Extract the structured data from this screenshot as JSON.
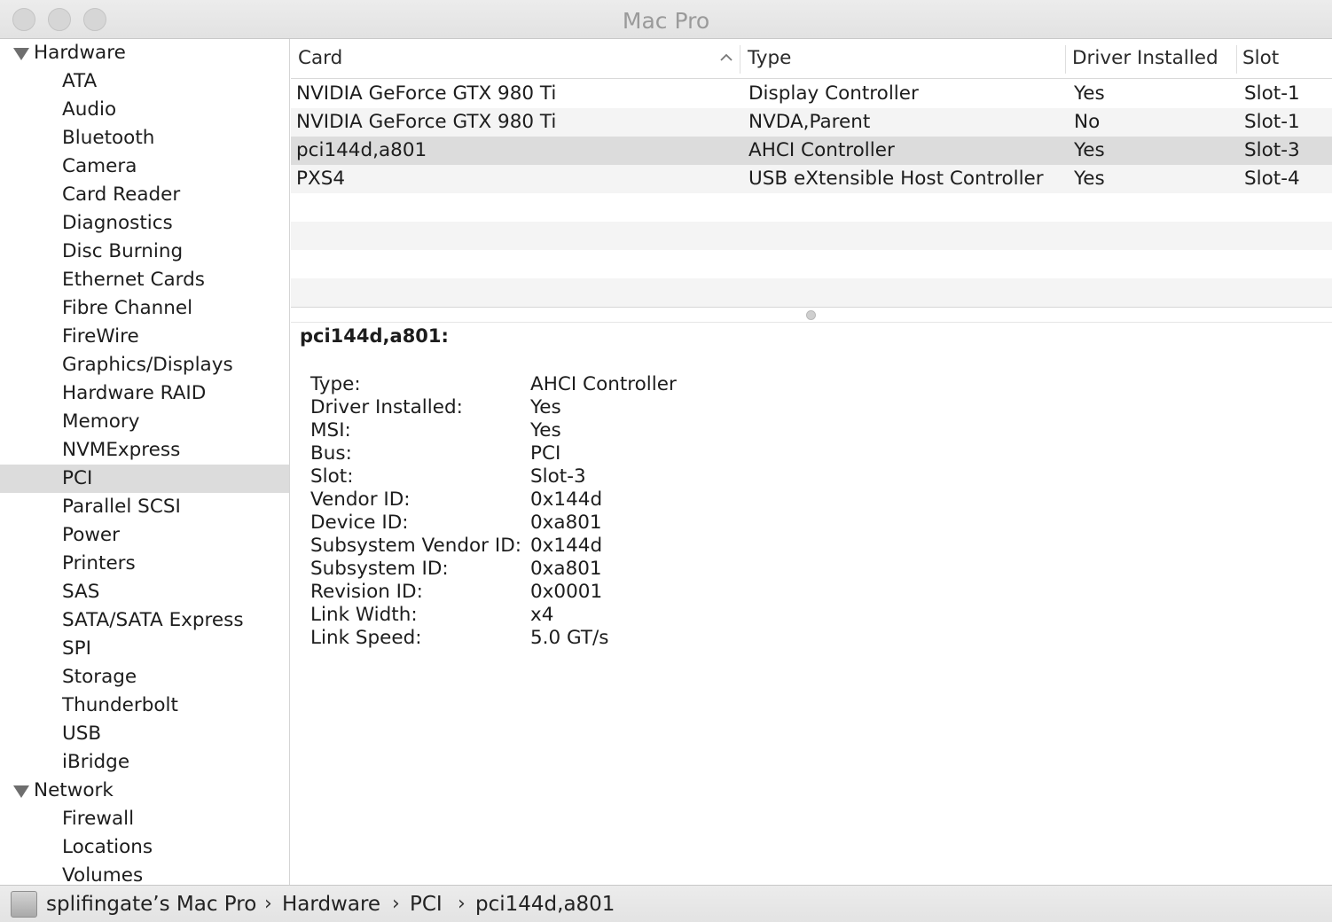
{
  "window": {
    "title": "Mac Pro"
  },
  "sidebar": {
    "groups": [
      {
        "label": "Hardware",
        "items": [
          "ATA",
          "Audio",
          "Bluetooth",
          "Camera",
          "Card Reader",
          "Diagnostics",
          "Disc Burning",
          "Ethernet Cards",
          "Fibre Channel",
          "FireWire",
          "Graphics/Displays",
          "Hardware RAID",
          "Memory",
          "NVMExpress",
          "PCI",
          "Parallel SCSI",
          "Power",
          "Printers",
          "SAS",
          "SATA/SATA Express",
          "SPI",
          "Storage",
          "Thunderbolt",
          "USB",
          "iBridge"
        ]
      },
      {
        "label": "Network",
        "items": [
          "Firewall",
          "Locations",
          "Volumes"
        ]
      }
    ],
    "selected": "PCI"
  },
  "table": {
    "columns": [
      "Card",
      "Type",
      "Driver Installed",
      "Slot"
    ],
    "sort_column": "Card",
    "sort_direction": "ascending",
    "rows": [
      [
        "NVIDIA GeForce GTX 980 Ti",
        "Display Controller",
        "Yes",
        "Slot-1"
      ],
      [
        "NVIDIA GeForce GTX 980 Ti",
        "NVDA,Parent",
        "No",
        "Slot-1"
      ],
      [
        "pci144d,a801",
        "AHCI Controller",
        "Yes",
        "Slot-3"
      ],
      [
        "PXS4",
        "USB eXtensible Host Controller",
        "Yes",
        "Slot-4"
      ]
    ],
    "selected_row": 2
  },
  "detail": {
    "title": "pci144d,a801:",
    "properties": [
      {
        "label": "Type:",
        "value": "AHCI Controller"
      },
      {
        "label": "Driver Installed:",
        "value": "Yes"
      },
      {
        "label": "MSI:",
        "value": "Yes"
      },
      {
        "label": "Bus:",
        "value": "PCI"
      },
      {
        "label": "Slot:",
        "value": "Slot-3"
      },
      {
        "label": "Vendor ID:",
        "value": "0x144d"
      },
      {
        "label": "Device ID:",
        "value": "0xa801"
      },
      {
        "label": "Subsystem Vendor ID:",
        "value": "0x144d"
      },
      {
        "label": "Subsystem ID:",
        "value": "0xa801"
      },
      {
        "label": "Revision ID:",
        "value": "0x0001"
      },
      {
        "label": "Link Width:",
        "value": "x4"
      },
      {
        "label": "Link Speed:",
        "value": "5.0 GT/s"
      }
    ]
  },
  "path": {
    "crumbs": [
      "splifingate’s Mac Pro",
      "Hardware",
      "PCI",
      "pci144d,a801"
    ],
    "separator": "›"
  },
  "colors": {
    "selection": "#dcdcdc",
    "stripe": "#f4f4f4",
    "title_text": "#9a9a9a"
  }
}
